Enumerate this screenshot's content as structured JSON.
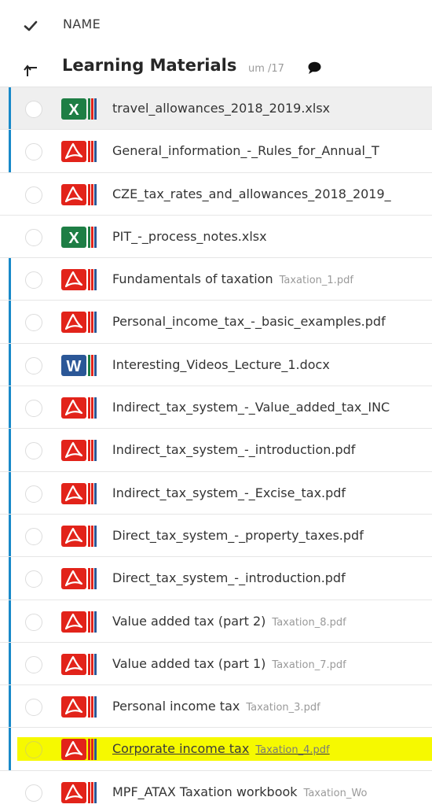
{
  "header": {
    "column_name": "NAME"
  },
  "folder": {
    "title": "Learning Materials",
    "meta": "um /17"
  },
  "colors": {
    "accent_bar": "#1889c9",
    "pdf_red": "#e2231a",
    "excel_green": "#1e7e45",
    "word_blue": "#2b5797",
    "highlight": "#f6f900"
  },
  "files": [
    {
      "type": "excel",
      "icon": "excel-icon",
      "name": "travel_allowances_2018_2019.xlsx",
      "sub": "",
      "selected": true,
      "bar": true,
      "highlight": false
    },
    {
      "type": "pdf",
      "icon": "pdf-icon",
      "name": "General_information_-_Rules_for_Annual_T",
      "sub": "",
      "selected": false,
      "bar": true,
      "highlight": false
    },
    {
      "type": "pdf",
      "icon": "pdf-icon",
      "name": "CZE_tax_rates_and_allowances_2018_2019_",
      "sub": "",
      "selected": false,
      "bar": false,
      "highlight": false
    },
    {
      "type": "excel",
      "icon": "excel-icon",
      "name": "PIT_-_process_notes.xlsx",
      "sub": "",
      "selected": false,
      "bar": false,
      "highlight": false
    },
    {
      "type": "pdf",
      "icon": "pdf-icon",
      "name": "Fundamentals of taxation",
      "sub": "Taxation_1.pdf",
      "selected": false,
      "bar": true,
      "highlight": false
    },
    {
      "type": "pdf",
      "icon": "pdf-icon",
      "name": "Personal_income_tax_-_basic_examples.pdf",
      "sub": "",
      "selected": false,
      "bar": true,
      "highlight": false
    },
    {
      "type": "word",
      "icon": "word-icon",
      "name": "Interesting_Videos_Lecture_1.docx",
      "sub": "",
      "selected": false,
      "bar": true,
      "highlight": false
    },
    {
      "type": "pdf",
      "icon": "pdf-icon",
      "name": "Indirect_tax_system_-_Value_added_tax_INC",
      "sub": "",
      "selected": false,
      "bar": true,
      "highlight": false
    },
    {
      "type": "pdf",
      "icon": "pdf-icon",
      "name": "Indirect_tax_system_-_introduction.pdf",
      "sub": "",
      "selected": false,
      "bar": true,
      "highlight": false
    },
    {
      "type": "pdf",
      "icon": "pdf-icon",
      "name": "Indirect_tax_system_-_Excise_tax.pdf",
      "sub": "",
      "selected": false,
      "bar": true,
      "highlight": false
    },
    {
      "type": "pdf",
      "icon": "pdf-icon",
      "name": "Direct_tax_system_-_property_taxes.pdf",
      "sub": "",
      "selected": false,
      "bar": true,
      "highlight": false
    },
    {
      "type": "pdf",
      "icon": "pdf-icon",
      "name": "Direct_tax_system_-_introduction.pdf",
      "sub": "",
      "selected": false,
      "bar": true,
      "highlight": false
    },
    {
      "type": "pdf",
      "icon": "pdf-icon",
      "name": "Value added tax (part 2)",
      "sub": "Taxation_8.pdf",
      "selected": false,
      "bar": true,
      "highlight": false
    },
    {
      "type": "pdf",
      "icon": "pdf-icon",
      "name": "Value added tax (part 1)",
      "sub": "Taxation_7.pdf",
      "selected": false,
      "bar": true,
      "highlight": false
    },
    {
      "type": "pdf",
      "icon": "pdf-icon",
      "name": "Personal income tax",
      "sub": "Taxation_3.pdf",
      "selected": false,
      "bar": true,
      "highlight": false
    },
    {
      "type": "pdf",
      "icon": "pdf-icon",
      "name": "Corporate income tax",
      "sub": "Taxation_4.pdf",
      "selected": false,
      "bar": true,
      "highlight": true
    },
    {
      "type": "pdf",
      "icon": "pdf-icon",
      "name": "MPF_ATAX Taxation workbook",
      "sub": "Taxation_Wo",
      "selected": false,
      "bar": false,
      "highlight": false
    }
  ]
}
